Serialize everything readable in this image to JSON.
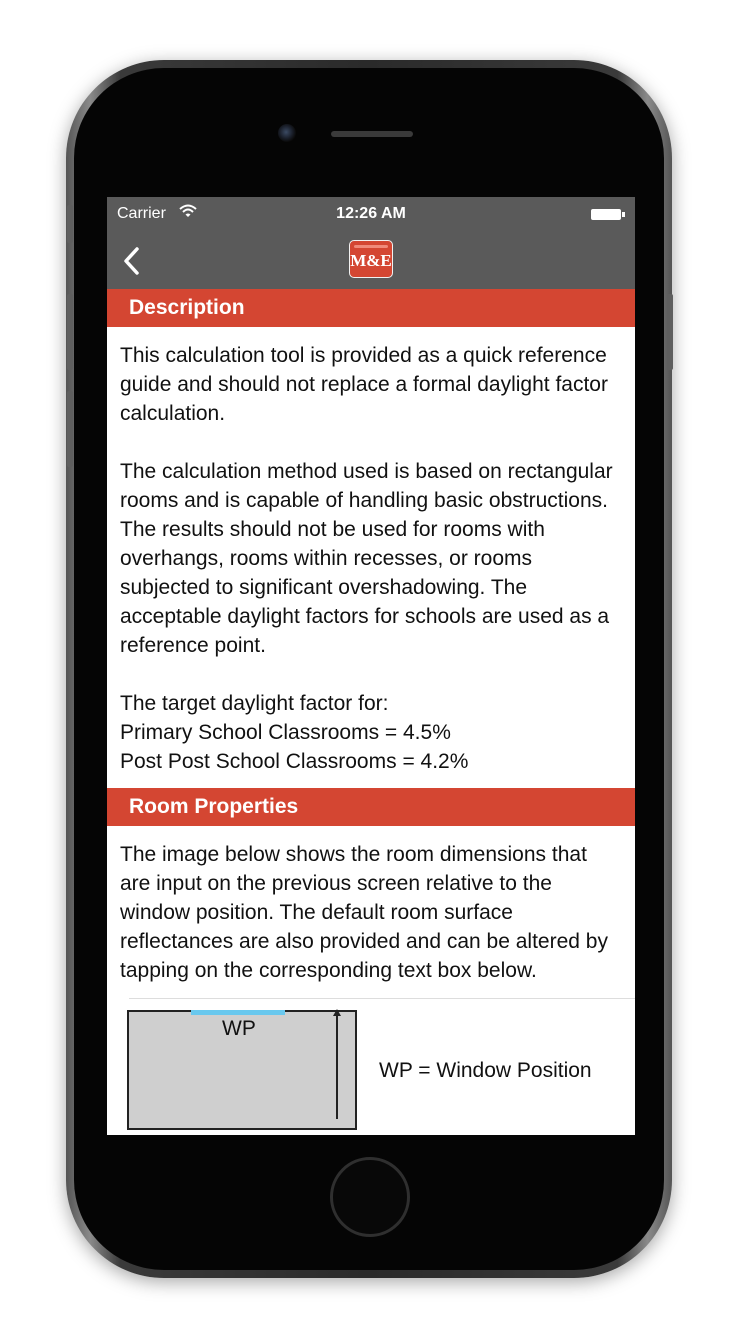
{
  "status_bar": {
    "carrier": "Carrier",
    "time": "12:26 AM",
    "wifi_icon": "wifi-icon",
    "battery_icon": "battery-icon"
  },
  "nav": {
    "back_icon": "chevron-left-icon",
    "logo_text": "M&E",
    "bar_color": "#5a5a5a"
  },
  "accent_color": "#d44632",
  "sections": {
    "description": {
      "title": "Description",
      "paragraphs": [
        "This calculation tool is provided as a quick reference guide and should not replace a formal daylight factor calculation.",
        "The calculation method used is based on rectangular rooms and is capable of handling basic obstructions. The results should not be used for rooms with overhangs, rooms within recesses, or rooms subjected to significant overshadowing. The acceptable daylight factors for schools are used as a reference point."
      ],
      "target_intro": "The target daylight factor for:",
      "target_primary": "Primary School Classrooms = 4.5%",
      "target_post": "Post Post School Classrooms = 4.2%"
    },
    "room_properties": {
      "title": "Room Properties",
      "paragraph": "The image below shows the room dimensions that are input on the previous screen relative to the window position. The default room surface reflectances are also provided and can be altered by tapping on the corresponding text box below.",
      "diagram": {
        "window_label": "WP",
        "legend": "WP = Window Position"
      }
    }
  }
}
